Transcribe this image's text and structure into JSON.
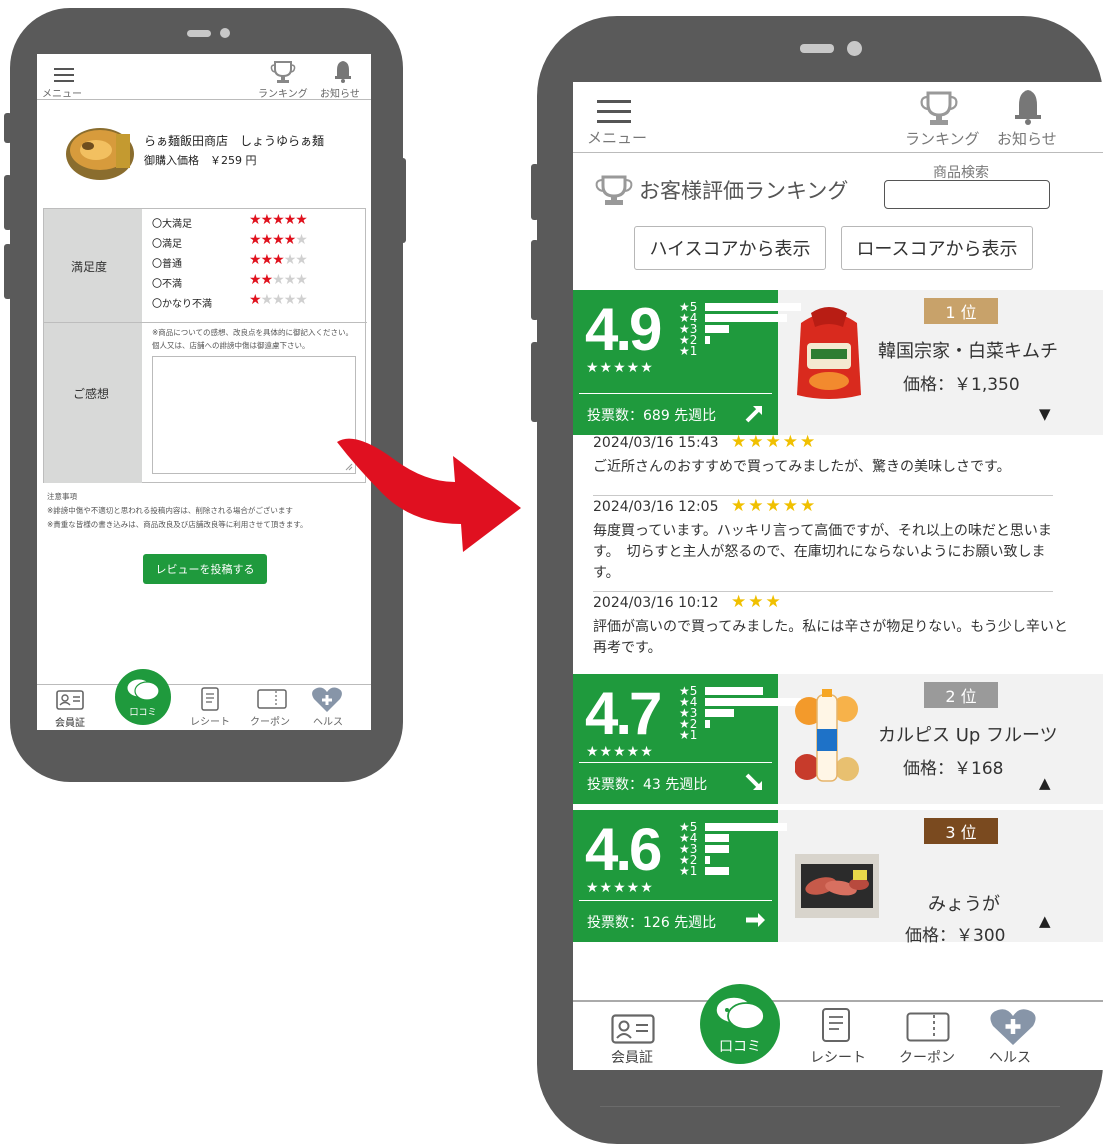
{
  "left_screen": {
    "header": {
      "menu_label": "メニュー",
      "ranking_label": "ランキング",
      "notice_label": "お知らせ"
    },
    "product": {
      "name": "らぁ麺飯田商店　しょうゆらぁ麺",
      "price_line": "御購入価格　￥259 円"
    },
    "form": {
      "satisfaction_label": "満足度",
      "options": [
        {
          "label": "〇大満足",
          "stars": 5
        },
        {
          "label": "〇満足",
          "stars": 4
        },
        {
          "label": "〇普通",
          "stars": 3
        },
        {
          "label": "〇不満",
          "stars": 2
        },
        {
          "label": "〇かなり不満",
          "stars": 1
        }
      ],
      "comment_label": "ご感想",
      "comment_note_1": "※商品についての感想、改良点を具体的に御記入ください。",
      "comment_note_2": "個人又は、店舗への誹謗中傷は御遠慮下さい。"
    },
    "notes": {
      "title": "注意事項",
      "line_1": "※誹謗中傷や不適切と思われる投稿内容は、削除される場合がございます",
      "line_2": "※貴重な皆様の書き込みは、商品改良及び店舗改良等に利用させて頂きます。"
    },
    "submit_label": "レビューを投稿する",
    "nav": {
      "member": "会員証",
      "kuchikomi": "口コミ",
      "receipt": "レシート",
      "coupon": "クーポン",
      "health": "ヘルス"
    }
  },
  "right_screen": {
    "header": {
      "menu_label": "メニュー",
      "ranking_label": "ランキング",
      "notice_label": "お知らせ"
    },
    "page_title": "お客様評価ランキング",
    "search_label": "商品検索",
    "sort_high_label": "ハイスコアから表示",
    "sort_low_label": "ロースコアから表示",
    "items": [
      {
        "score": "4.9",
        "bars": [
          1.0,
          0.85,
          0.25,
          0.05,
          0.0
        ],
        "vote_text": "投票数：689  先週比",
        "trend": "up",
        "rank": "1 位",
        "rank_color": "#c8a26a",
        "name": "韓国宗家・白菜キムチ",
        "price": "価格：￥1,350",
        "toggle": "▼"
      },
      {
        "score": "4.7",
        "bars": [
          0.6,
          1.0,
          0.3,
          0.05,
          0.0
        ],
        "vote_text": "投票数：43  先週比",
        "trend": "down",
        "rank": "2 位",
        "rank_color": "#9a9a9a",
        "name": "カルピス Up フルーツ",
        "price": "価格：￥168",
        "toggle": "▲"
      },
      {
        "score": "4.6",
        "bars": [
          0.85,
          0.25,
          0.25,
          0.05,
          0.25
        ],
        "vote_text": "投票数：126  先週比",
        "trend": "right",
        "rank": "3 位",
        "rank_color": "#7a4a1f",
        "name": "みょうが",
        "price": "価格：￥300",
        "toggle": "▲"
      }
    ],
    "star_labels": [
      "★5",
      "★4",
      "★3",
      "★2",
      "★1"
    ],
    "reviews": [
      {
        "date": "2024/03/16 15:43",
        "stars": 5,
        "text": "ご近所さんのおすすめで買ってみましたが、驚きの美味しさです。"
      },
      {
        "date": "2024/03/16 12:05",
        "stars": 5,
        "text": "毎度買っています。ハッキリ言って高価ですが、それ以上の味だと思います。　切らすと主人が怒るので、在庫切れにならないようにお願い致します。"
      },
      {
        "date": "2024/03/16 10:12",
        "stars": 3,
        "text": "評価が高いので買ってみました。私には辛さが物足りない。もう少し辛いと再考です。"
      }
    ],
    "nav": {
      "member": "会員証",
      "kuchikomi": "口コミ",
      "receipt": "レシート",
      "coupon": "クーポン",
      "health": "ヘルス"
    }
  },
  "colors": {
    "green": "#1f9a3d",
    "red_star": "#e0111d",
    "yellow_star": "#f0c000",
    "arrow": "#e01020"
  }
}
